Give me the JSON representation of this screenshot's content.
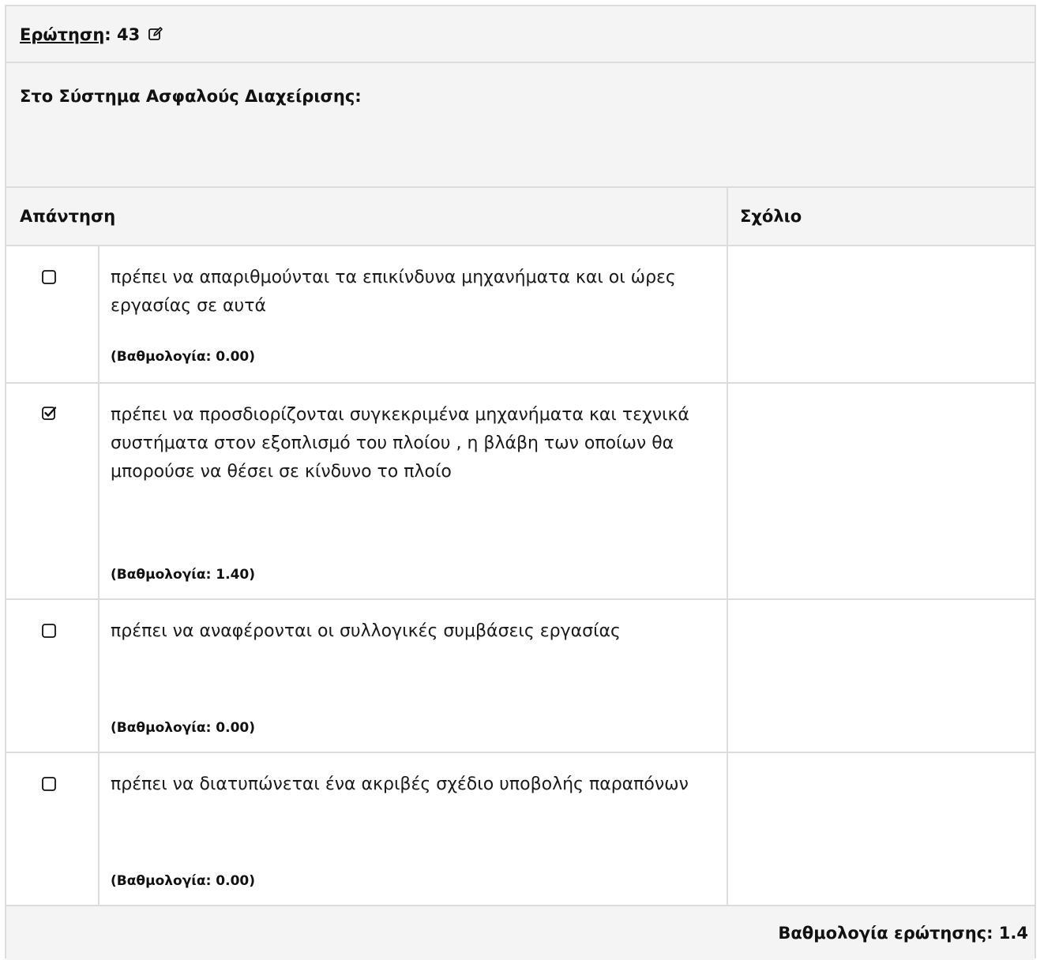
{
  "question": {
    "label": "Ερώτηση",
    "number_suffix": ": 43",
    "edit_icon": "pencil-square-icon",
    "text": "Στο Σύστημα Ασφαλούς Διαχείρισης:"
  },
  "columns": {
    "answer": "Απάντηση",
    "comment": "Σχόλιο"
  },
  "answers": [
    {
      "checked": false,
      "text": "πρέπει να απαριθμούνται τα επικίνδυνα μηχανήματα και οι ώρες εργασίας σε αυτά",
      "score": "(Βαθμολογία: 0.00)",
      "comment": ""
    },
    {
      "checked": true,
      "text": "πρέπει να προσδιορίζονται συγκεκριμένα μηχανήματα και τεχνικά συστήματα στον εξοπλισμό του πλοίου , η βλάβη των οποίων θα μπορούσε να θέσει σε κίνδυνο το πλοίο",
      "score": "(Βαθμολογία: 1.40)",
      "comment": ""
    },
    {
      "checked": false,
      "text": "πρέπει να αναφέρονται οι συλλογικές συμβάσεις εργασίας",
      "score": "(Βαθμολογία: 0.00)",
      "comment": ""
    },
    {
      "checked": false,
      "text": "πρέπει να διατυπώνεται ένα ακριβές σχέδιο υποβολής παραπόνων",
      "score": "(Βαθμολογία: 0.00)",
      "comment": ""
    }
  ],
  "footer": {
    "total": "Βαθμολογία ερώτησης: 1.4"
  },
  "colors": {
    "header_bg": "#f4f4f4",
    "border": "#dcdcdc",
    "text": "#111111"
  }
}
